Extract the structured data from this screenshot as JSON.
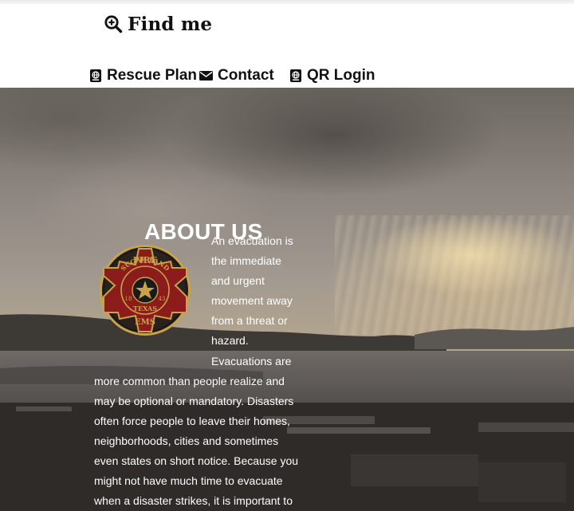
{
  "brand": {
    "title": "Find me",
    "icon": "search-plus-icon"
  },
  "nav": [
    {
      "label": "Rescue Plan",
      "icon": "passport-icon"
    },
    {
      "label": "Contact",
      "icon": "envelope-icon"
    },
    {
      "label": "QR Login",
      "icon": "passport-icon"
    }
  ],
  "about": {
    "title": "ABOUT US",
    "paragraph": "An evacuation is the immediate and urgent movement away from a threat or hazard. Evacuations are more common than people realize and may be optional or mandatory. Disasters often force people to leave their homes, neighborhoods, cities and sometimes even states on short notice. Because you might not have much time to evacuate when a disaster strikes, it is important to"
  },
  "badge": {
    "top_text": "FIRE",
    "arc_text": "SUGAR LAND",
    "left_year": "18",
    "right_year": "43",
    "state": "TEXAS",
    "bottom_text": "EMS"
  },
  "colors": {
    "badge_red": "#8c1c1c",
    "badge_gold": "#c9a24a",
    "text": "#111111"
  }
}
